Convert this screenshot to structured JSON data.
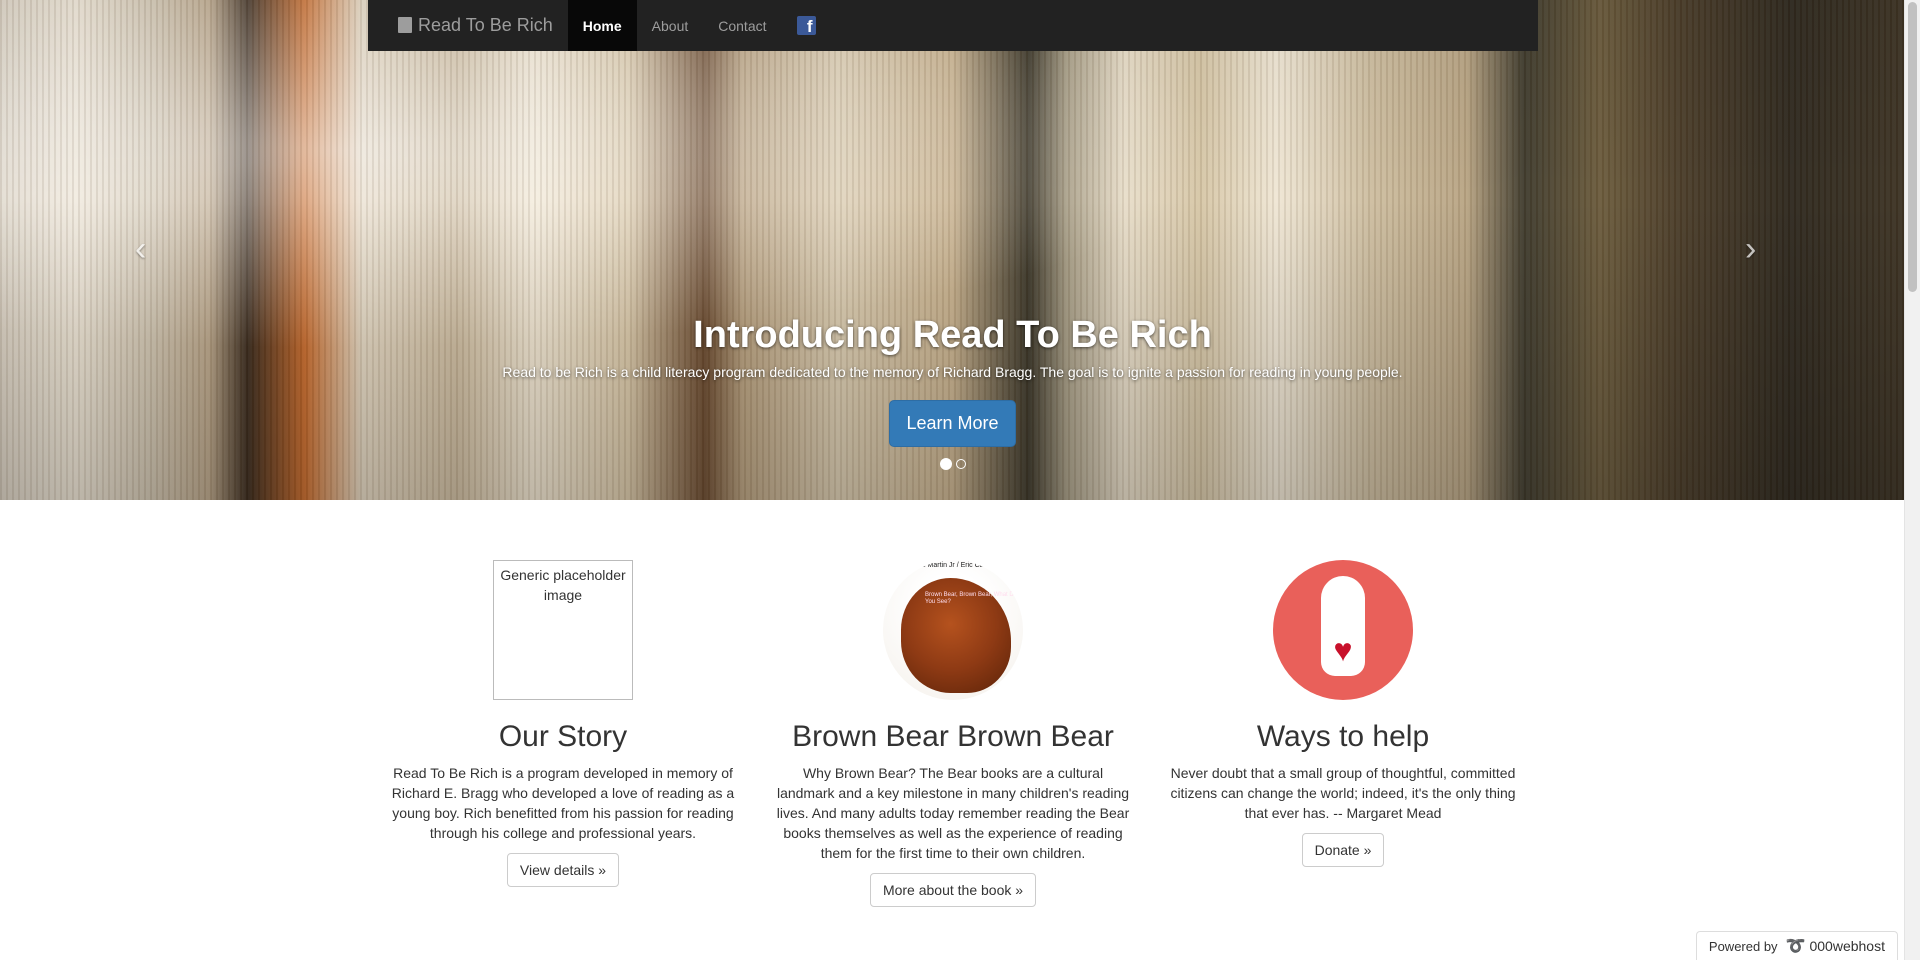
{
  "navbar": {
    "brand": "Read To Be Rich",
    "items": [
      {
        "label": "Home",
        "active": true
      },
      {
        "label": "About",
        "active": false
      },
      {
        "label": "Contact",
        "active": false
      }
    ],
    "facebook_icon": "facebook-icon"
  },
  "hero": {
    "title": "Introducing Read To Be Rich",
    "text": "Read to be Rich is a child literacy program dedicated to the memory of Richard Bragg. The goal is to ignite a passion for reading in young people.",
    "button": "Learn More",
    "prev_icon": "‹",
    "next_icon": "›",
    "slides": 2,
    "active_slide": 1
  },
  "columns": [
    {
      "image_alt": "Generic placeholder image",
      "title": "Our Story",
      "text": "Read To Be Rich is a program developed in memory of Richard E. Bragg who developed a love of reading as a young boy. Rich benefitted from his passion for reading through his college and professional years.",
      "button": "View details »"
    },
    {
      "image_top_text": "ll Martin Jr / Eric Ca",
      "image_sub_text": "Brown Bear, Brown Bear, What Do You See?",
      "title": "Brown Bear Brown Bear",
      "text": "Why Brown Bear? The Bear books are a cultural landmark and a key milestone in many children's reading lives. And many adults today remember reading the Bear books themselves as well as the experience of reading them for the first time to their own children.",
      "button": "More about the book »"
    },
    {
      "image_icon": "hand-heart-icon",
      "title": "Ways to help",
      "text": "Never doubt that a small group of thoughtful, committed citizens can change the world; indeed, it's the only thing that ever has. -- Margaret Mead",
      "button": "Donate »"
    }
  ],
  "powered": {
    "label": "Powered by",
    "host": "000webhost"
  }
}
